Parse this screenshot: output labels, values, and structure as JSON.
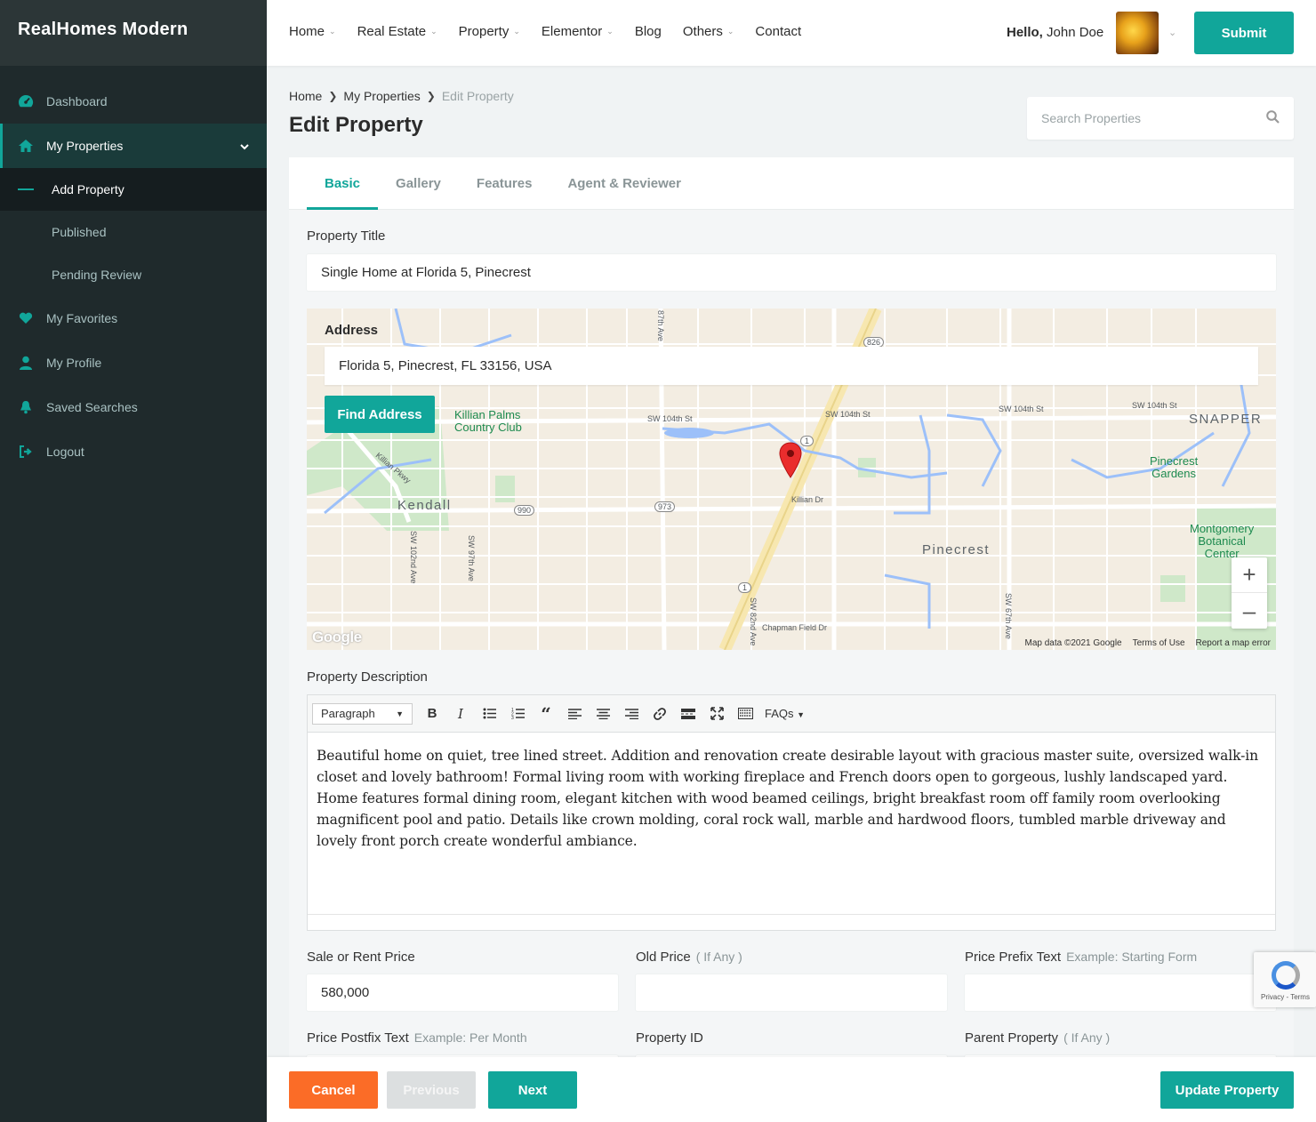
{
  "brand": "RealHomes Modern",
  "sidebar": {
    "items": [
      {
        "label": "Dashboard",
        "icon": "dashboard-icon"
      },
      {
        "label": "My Properties",
        "icon": "home-icon"
      },
      {
        "label": "My Favorites",
        "icon": "heart-icon"
      },
      {
        "label": "My Profile",
        "icon": "user-icon"
      },
      {
        "label": "Saved Searches",
        "icon": "bell-icon"
      },
      {
        "label": "Logout",
        "icon": "logout-icon"
      }
    ],
    "sub_items": [
      "Add Property",
      "Published",
      "Pending Review"
    ]
  },
  "header": {
    "menu": [
      "Home",
      "Real Estate",
      "Property",
      "Elementor",
      "Blog",
      "Others",
      "Contact"
    ],
    "hello_prefix": "Hello,",
    "user_name": "John Doe",
    "submit_label": "Submit"
  },
  "breadcrumb": [
    "Home",
    "My Properties",
    "Edit Property"
  ],
  "page_title": "Edit Property",
  "search": {
    "placeholder": "Search Properties"
  },
  "tabs": [
    "Basic",
    "Gallery",
    "Features",
    "Agent & Reviewer"
  ],
  "form": {
    "title_label": "Property Title",
    "title_value": "Single Home at Florida 5, Pinecrest",
    "address_label": "Address",
    "address_value": "Florida 5, Pinecrest, FL 33156, USA",
    "find_address": "Find Address",
    "description_label": "Property Description",
    "description": "Beautiful home on quiet, tree lined street. Addition and renovation create desirable layout with gracious master suite, oversized walk-in closet and lovely bathroom! Formal living room with working fireplace and French doors open to gorgeous, lushly landscaped yard. Home features formal dining room, elegant kitchen with wood beamed ceilings, bright breakfast room off family room overlooking magnificent pool and patio. Details like crown molding, coral rock wall, marble and hardwood floors, tumbled marble driveway and lovely front porch create wonderful ambiance.",
    "editor_format": "Paragraph",
    "editor_faqs": "FAQs",
    "price_label": "Sale or Rent Price",
    "price_value": "580,000",
    "old_price_label": "Old Price",
    "old_price_hint": "( If Any )",
    "prefix_label": "Price Prefix Text",
    "prefix_hint": "Example: Starting Form",
    "postfix_label": "Price Postfix Text",
    "postfix_hint": "Example: Per Month",
    "property_id_label": "Property ID",
    "parent_label": "Parent Property",
    "parent_hint": "( If Any )"
  },
  "map": {
    "places": [
      "Killian Palms",
      "Country Club",
      "Kendall",
      "Pinecrest",
      "SNAPPER",
      "Pinecrest",
      "Gardens",
      "Montgomery",
      "Botanical",
      "Center"
    ],
    "streets": [
      "SW 104th St",
      "SW 104th St",
      "SW 104th St",
      "SW 104th St",
      "Killian Dr",
      "Chapman Field Dr",
      "SW 97th Ave",
      "SW 102nd Ave",
      "SW 82nd Ave",
      "SW 67th Ave",
      "87th Ave",
      "Killian Pkwy"
    ],
    "shields": [
      "826",
      "1",
      "990",
      "973",
      "1"
    ],
    "attribution": "Map data ©2021 Google",
    "terms": "Terms of Use",
    "report": "Report a map error",
    "google": "Google"
  },
  "footer": {
    "cancel": "Cancel",
    "previous": "Previous",
    "next": "Next",
    "update": "Update Property"
  },
  "recaptcha": "Privacy - Terms",
  "colors": {
    "accent": "#11a69a",
    "cancel": "#fb6c27",
    "sidebar": "#1f2a2c"
  }
}
